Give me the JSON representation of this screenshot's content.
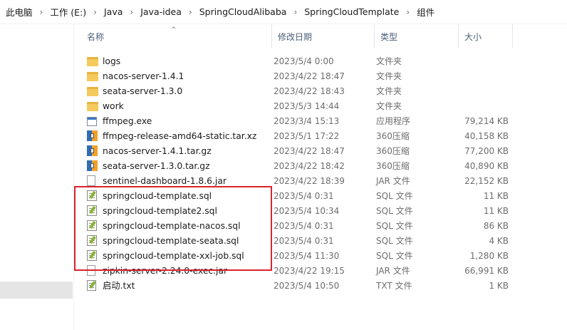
{
  "breadcrumb": [
    "此电脑",
    "工作 (E:)",
    "Java",
    "Java-idea",
    "SpringCloudAlibaba",
    "SpringCloudTemplate",
    "组件"
  ],
  "columns": {
    "name": "名称",
    "date": "修改日期",
    "type": "类型",
    "size": "大小"
  },
  "files": [
    {
      "name": "logs",
      "date": "2023/5/4 0:00",
      "type": "文件夹",
      "size": "",
      "icon": "folder-icon"
    },
    {
      "name": "nacos-server-1.4.1",
      "date": "2023/4/22 18:47",
      "type": "文件夹",
      "size": "",
      "icon": "folder-icon"
    },
    {
      "name": "seata-server-1.3.0",
      "date": "2023/4/22 18:43",
      "type": "文件夹",
      "size": "",
      "icon": "folder-icon"
    },
    {
      "name": "work",
      "date": "2023/5/3 14:44",
      "type": "文件夹",
      "size": "",
      "icon": "folder-icon"
    },
    {
      "name": "ffmpeg.exe",
      "date": "2023/3/4 15:13",
      "type": "应用程序",
      "size": "79,214 KB",
      "icon": "exe-icon"
    },
    {
      "name": "ffmpeg-release-amd64-static.tar.xz",
      "date": "2023/5/1 17:22",
      "type": "360压缩",
      "size": "40,158 KB",
      "icon": "archive-icon"
    },
    {
      "name": "nacos-server-1.4.1.tar.gz",
      "date": "2023/4/22 18:47",
      "type": "360压缩",
      "size": "77,200 KB",
      "icon": "archive-icon"
    },
    {
      "name": "seata-server-1.3.0.tar.gz",
      "date": "2023/4/22 18:42",
      "type": "360压缩",
      "size": "40,890 KB",
      "icon": "archive-icon"
    },
    {
      "name": "sentinel-dashboard-1.8.6.jar",
      "date": "2023/4/22 18:39",
      "type": "JAR 文件",
      "size": "22,152 KB",
      "icon": "jar-file-icon"
    },
    {
      "name": "springcloud-template.sql",
      "date": "2023/5/4 0:31",
      "type": "SQL 文件",
      "size": "11 KB",
      "icon": "sql-file-icon"
    },
    {
      "name": "springcloud-template2.sql",
      "date": "2023/5/4 10:34",
      "type": "SQL 文件",
      "size": "11 KB",
      "icon": "sql-file-icon"
    },
    {
      "name": "springcloud-template-nacos.sql",
      "date": "2023/5/4 0:31",
      "type": "SQL 文件",
      "size": "86 KB",
      "icon": "sql-file-icon"
    },
    {
      "name": "springcloud-template-seata.sql",
      "date": "2023/5/4 0:31",
      "type": "SQL 文件",
      "size": "4 KB",
      "icon": "sql-file-icon"
    },
    {
      "name": "springcloud-template-xxl-job.sql",
      "date": "2023/5/4 11:30",
      "type": "SQL 文件",
      "size": "1,280 KB",
      "icon": "sql-file-icon"
    },
    {
      "name": "zipkin-server-2.24.0-exec.jar",
      "date": "2023/4/22 19:15",
      "type": "JAR 文件",
      "size": "66,991 KB",
      "icon": "jar-file-icon"
    },
    {
      "name": "启动.txt",
      "date": "2023/5/4 10:50",
      "type": "TXT 文件",
      "size": "1 KB",
      "icon": "txt-file-icon"
    }
  ],
  "colors": {
    "highlight": "#d9232d",
    "folder": "#f4c95d",
    "header_text": "#4c607a"
  }
}
